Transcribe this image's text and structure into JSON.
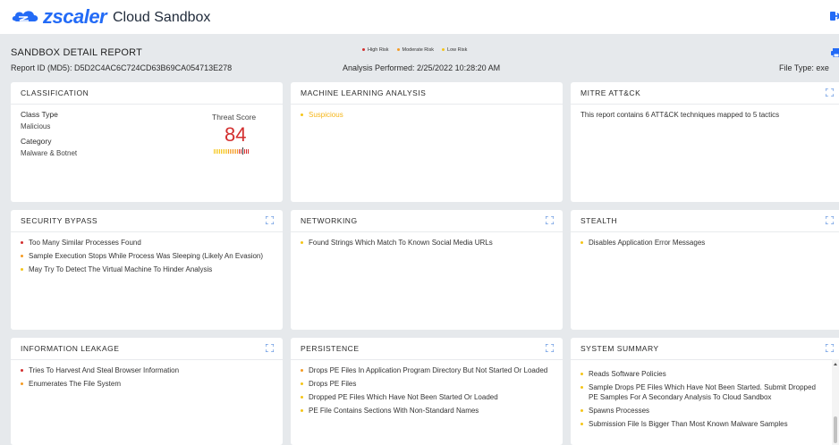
{
  "app": {
    "brand": "zscaler",
    "title": "Cloud Sandbox"
  },
  "report": {
    "title": "SANDBOX DETAIL REPORT",
    "report_id": "Report ID (MD5): D5D2C4AC6C724CD63B69CA054713E278",
    "analysis": "Analysis Performed: 2/25/2022 10:28:20 AM",
    "file_type": "File Type: exe",
    "legend": [
      {
        "label": "High Risk",
        "color": "#d32f2f"
      },
      {
        "label": "Moderate Risk",
        "color": "#f59b23"
      },
      {
        "label": "Low Risk",
        "color": "#f5c518"
      }
    ]
  },
  "colors": {
    "high": "#d32f2f",
    "moderate": "#f59b23",
    "low": "#f5c518",
    "brand": "#236bf6"
  },
  "cards": {
    "classification": {
      "title": "CLASSIFICATION",
      "class_type_label": "Class Type",
      "class_type_value": "Malicious",
      "category_label": "Category",
      "category_value": "Malware & Botnet",
      "threat_score_label": "Threat Score",
      "threat_score": "84",
      "threat_level": 0.84
    },
    "ml": {
      "title": "MACHINE LEARNING ANALYSIS",
      "items": [
        {
          "text": "Suspicious",
          "level": "low"
        }
      ]
    },
    "mitre": {
      "title": "MITRE ATT&CK",
      "text": "This report contains 6 ATT&CK techniques mapped to 5 tactics"
    },
    "security_bypass": {
      "title": "SECURITY BYPASS",
      "items": [
        {
          "text": "Too Many Similar Processes Found",
          "level": "high"
        },
        {
          "text": "Sample Execution Stops While Process Was Sleeping (Likely An Evasion)",
          "level": "moderate"
        },
        {
          "text": "May Try To Detect The Virtual Machine To Hinder Analysis",
          "level": "low"
        }
      ]
    },
    "networking": {
      "title": "NETWORKING",
      "items": [
        {
          "text": "Found Strings Which Match To Known Social Media URLs",
          "level": "low"
        }
      ]
    },
    "stealth": {
      "title": "STEALTH",
      "items": [
        {
          "text": "Disables Application Error Messages",
          "level": "low"
        }
      ]
    },
    "info_leakage": {
      "title": "INFORMATION LEAKAGE",
      "items": [
        {
          "text": "Tries To Harvest And Steal Browser Information",
          "level": "high"
        },
        {
          "text": "Enumerates The File System",
          "level": "moderate"
        }
      ]
    },
    "persistence": {
      "title": "PERSISTENCE",
      "items": [
        {
          "text": "Drops PE Files In Application Program Directory But Not Started Or Loaded",
          "level": "moderate"
        },
        {
          "text": "Drops PE Files",
          "level": "low"
        },
        {
          "text": "Dropped PE Files Which Have Not Been Started Or Loaded",
          "level": "low"
        },
        {
          "text": "PE File Contains Sections With Non-Standard Names",
          "level": "low"
        }
      ]
    },
    "system_summary": {
      "title": "SYSTEM SUMMARY",
      "items": [
        {
          "text": "Reads Software Policies",
          "level": "low"
        },
        {
          "text": "Sample Drops PE Files Which Have Not Been Started. Submit Dropped PE Samples For A Secondary Analysis To Cloud Sandbox",
          "level": "low"
        },
        {
          "text": "Spawns Processes",
          "level": "low"
        },
        {
          "text": "Submission File Is Bigger Than Most Known Malware Samples",
          "level": "low"
        }
      ]
    }
  }
}
